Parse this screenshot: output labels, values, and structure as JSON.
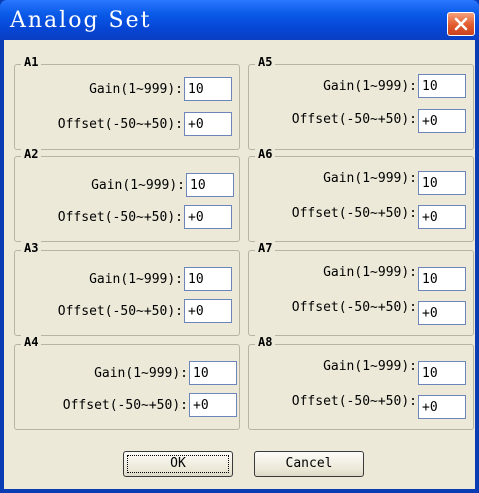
{
  "window": {
    "title": "Analog Set"
  },
  "groups": [
    {
      "name": "A1",
      "gain_label": "Gain(1~999):",
      "gain_value": "10",
      "offset_label": "Offset(-50~+50):",
      "offset_value": "+0"
    },
    {
      "name": "A2",
      "gain_label": "Gain(1~999):",
      "gain_value": "10",
      "offset_label": "Offset(-50~+50):",
      "offset_value": "+0"
    },
    {
      "name": "A3",
      "gain_label": "Gain(1~999):",
      "gain_value": "10",
      "offset_label": "Offset(-50~+50):",
      "offset_value": "+0"
    },
    {
      "name": "A4",
      "gain_label": "Gain(1~999):",
      "gain_value": "10",
      "offset_label": "Offset(-50~+50):",
      "offset_value": "+0"
    },
    {
      "name": "A5",
      "gain_label": "Gain(1~999):",
      "gain_value": "10",
      "offset_label": "Offset(-50~+50):",
      "offset_value": "+0"
    },
    {
      "name": "A6",
      "gain_label": "Gain(1~999):",
      "gain_value": "10",
      "offset_label": "Offset(-50~+50):",
      "offset_value": "+0"
    },
    {
      "name": "A7",
      "gain_label": "Gain(1~999):",
      "gain_value": "10",
      "offset_label": "Offset(-50~+50):",
      "offset_value": "+0"
    },
    {
      "name": "A8",
      "gain_label": "Gain(1~999):",
      "gain_value": "10",
      "offset_label": "Offset(-50~+50):",
      "offset_value": "+0"
    }
  ],
  "buttons": {
    "ok": "OK",
    "cancel": "Cancel"
  },
  "icons": {
    "close": "close-icon"
  },
  "colors": {
    "title_bar": "#0a5ae8",
    "close_button": "#e25a2d",
    "dialog_bg": "#ece9d8"
  }
}
